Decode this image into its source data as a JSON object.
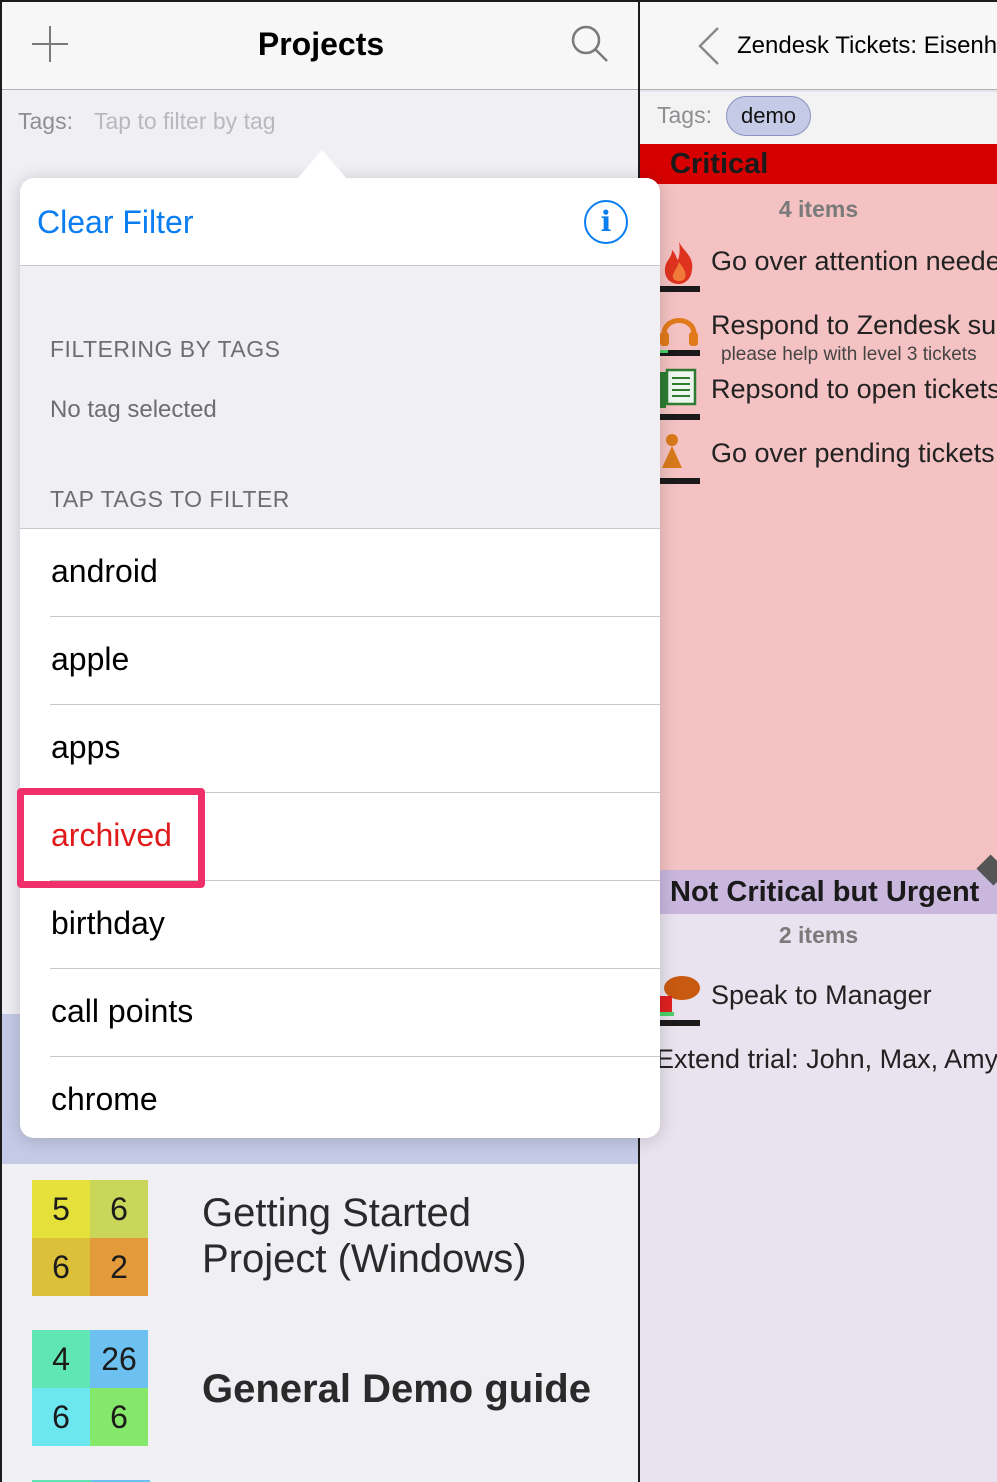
{
  "left_nav": {
    "add_icon": "plus-icon",
    "title": "Projects",
    "search_icon": "search-icon"
  },
  "left_tags_bar": {
    "label": "Tags:",
    "placeholder": "Tap to filter by tag"
  },
  "popover": {
    "clear_filter_label": "Clear Filter",
    "info_glyph": "i",
    "filtering_header": "FILTERING BY TAGS",
    "filtering_value": "No tag selected",
    "tap_header": "TAP TAGS TO FILTER",
    "tags": [
      "android",
      "apple",
      "apps",
      "archived",
      "birthday",
      "call points",
      "chrome"
    ],
    "highlighted_tag": "archived",
    "highlight_color": "#f0306a",
    "highlighted_text_color": "#e01b1b"
  },
  "projects": [
    {
      "counts": [
        "5",
        "6",
        "6",
        "2"
      ],
      "colors": [
        "#e6e03a",
        "#c9d65a",
        "#dcc03a",
        "#e39a3a"
      ],
      "name_line1": "Getting Started",
      "name_line2": "Project (Windows)"
    },
    {
      "counts": [
        "4",
        "26",
        "6",
        "6"
      ],
      "colors": [
        "#5fe6b4",
        "#6cc1f0",
        "#6ce6ef",
        "#86e86a"
      ],
      "name_line1": "General Demo guide"
    }
  ],
  "right_nav": {
    "back_icon": "chevron-left-icon",
    "title": "Zendesk Tickets: Eisenhower"
  },
  "right_tags": {
    "label": "Tags:",
    "pill": "demo"
  },
  "quadrants": {
    "critical": {
      "title": "Critical",
      "count": "4 items",
      "color": "#d60000",
      "tasks": [
        {
          "icon": "fire-icon",
          "text": "Go over attention needed tickets",
          "sub": ""
        },
        {
          "icon": "headset-icon",
          "text": "Respond to Zendesk support",
          "sub": "please help with level 3 tickets"
        },
        {
          "icon": "document-icon",
          "text": "Repsond to open tickets",
          "sub": ""
        },
        {
          "icon": "person-icon",
          "text": "Go over pending tickets",
          "sub": ""
        }
      ]
    },
    "urgent": {
      "title": "Not Critical but Urgent",
      "count": "2 items",
      "color": "#c9b7dd",
      "tasks": [
        {
          "icon": "speech-bubble-icon",
          "text": "Speak to Manager"
        },
        {
          "icon": "",
          "text": "Extend trial: John, Max, Amy"
        }
      ]
    }
  }
}
